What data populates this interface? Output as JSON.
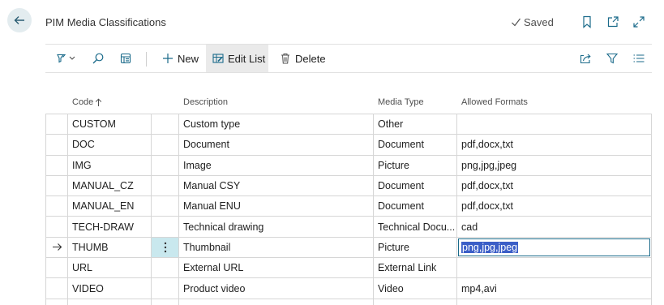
{
  "header": {
    "title": "PIM Media Classifications",
    "saved_label": "Saved"
  },
  "toolbar": {
    "new_label": "New",
    "edit_list_label": "Edit List",
    "delete_label": "Delete"
  },
  "columns": {
    "code": "Code",
    "description": "Description",
    "media_type": "Media Type",
    "allowed_formats": "Allowed Formats"
  },
  "rows": [
    {
      "code": "CUSTOM",
      "description": "Custom type",
      "media_type": "Other",
      "allowed_formats": ""
    },
    {
      "code": "DOC",
      "description": "Document",
      "media_type": "Document",
      "allowed_formats": "pdf,docx,txt"
    },
    {
      "code": "IMG",
      "description": "Image",
      "media_type": "Picture",
      "allowed_formats": "png,jpg,jpeg"
    },
    {
      "code": "MANUAL_CZ",
      "description": "Manual CSY",
      "media_type": "Document",
      "allowed_formats": "pdf,docx,txt"
    },
    {
      "code": "MANUAL_EN",
      "description": "Manual ENU",
      "media_type": "Document",
      "allowed_formats": "pdf,docx,txt"
    },
    {
      "code": "TECH-DRAW",
      "description": "Technical drawing",
      "media_type": "Technical Docu...",
      "allowed_formats": "cad"
    },
    {
      "code": "THUMB",
      "description": "Thumbnail",
      "media_type": "Picture",
      "allowed_formats": "png,jpg,jpeg"
    },
    {
      "code": "URL",
      "description": "External URL",
      "media_type": "External Link",
      "allowed_formats": ""
    },
    {
      "code": "VIDEO",
      "description": "Product video",
      "media_type": "Video",
      "allowed_formats": "mp4,avi"
    }
  ],
  "colors": {
    "accent": "#1a6a8a",
    "selection": "#3b5ec7",
    "back_button_bg": "#e3ecef",
    "menu_cell_bg": "#c9e8ee"
  },
  "icons": [
    "back-arrow-icon",
    "checkmark-icon",
    "bookmark-icon",
    "open-new-window-icon",
    "expand-icon",
    "filter-pane-icon",
    "search-icon",
    "show-as-icon",
    "plus-icon",
    "edit-list-icon",
    "trash-icon",
    "share-icon",
    "filter-icon",
    "list-view-icon",
    "sort-ascending-icon",
    "row-arrow-icon",
    "more-options-icon"
  ]
}
